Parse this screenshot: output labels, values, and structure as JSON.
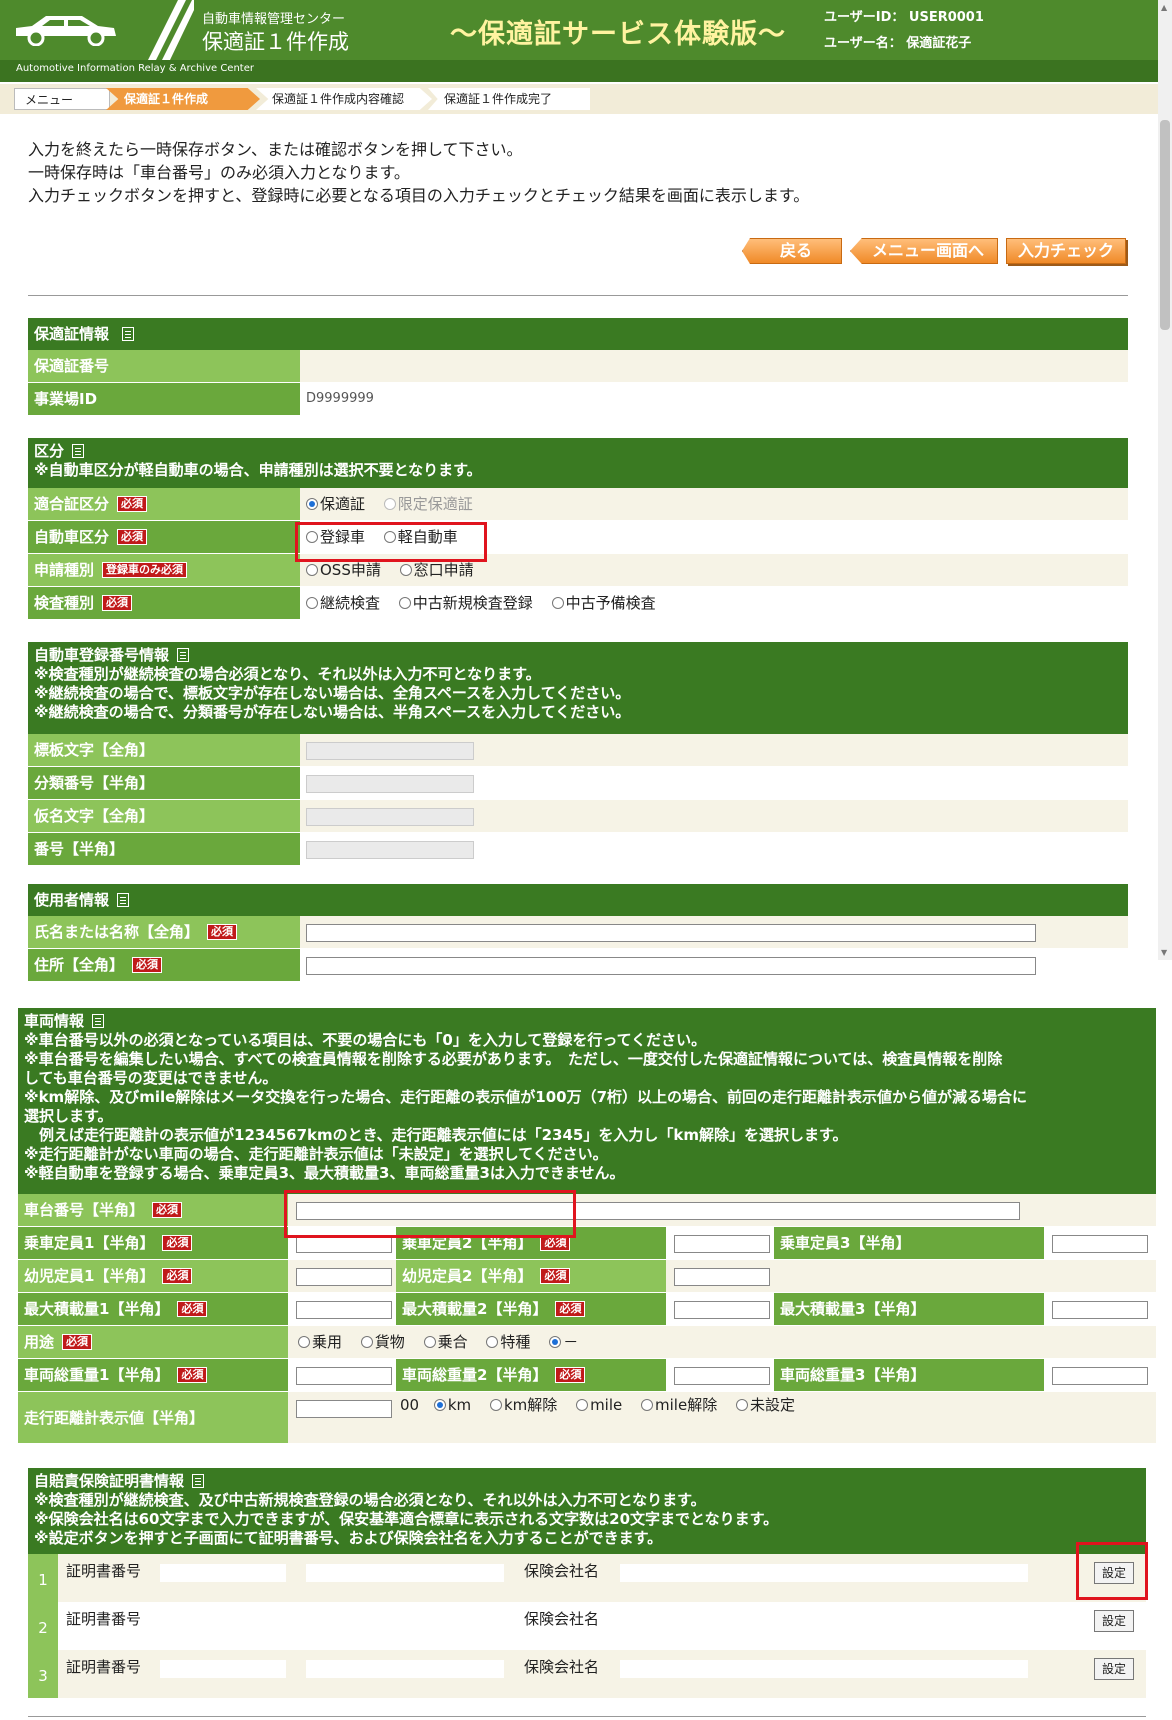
{
  "header": {
    "org": "自動車情報管理センター",
    "subtitle": "保適証１件作成",
    "title": "～保適証サービス体験版～",
    "user_id": "ユーザーID： USER0001",
    "user_name": "ユーザー名： 保適証花子",
    "english": "Automotive Information Relay & Archive Center"
  },
  "breadcrumb": [
    "メニュー",
    "保適証１件作成",
    "保適証１件作成内容確認",
    "保適証１件作成完了"
  ],
  "instructions": [
    "入力を終えたら一時保存ボタン、または確認ボタンを押して下さい。",
    "一時保存時は「車台番号」のみ必須入力となります。",
    "入力チェックボタンを押すと、登録時に必要となる項目の入力チェックとチェック結果を画面に表示します。"
  ],
  "buttons": {
    "back": "戻る",
    "menu": "メニュー画面へ",
    "check": "入力チェック"
  },
  "req_label": "必須",
  "req_reg_only": "登録車のみ必須",
  "sec1": {
    "title": "保適証情報",
    "rows": [
      {
        "label": "保適証番号",
        "value": ""
      },
      {
        "label": "事業場ID",
        "value": "D9999999"
      }
    ]
  },
  "sec2": {
    "title": "区分",
    "note": "※自動車区分が軽自動車の場合、申請種別は選択不要となります。",
    "rows": [
      {
        "label": "適合証区分",
        "options": [
          "保適証",
          "限定保適証"
        ]
      },
      {
        "label": "自動車区分",
        "options": [
          "登録車",
          "軽自動車"
        ]
      },
      {
        "label": "申請種別",
        "options": [
          "OSS申請",
          "窓口申請"
        ]
      },
      {
        "label": "検査種別",
        "options": [
          "継続検査",
          "中古新規検査登録",
          "中古予備検査"
        ]
      }
    ]
  },
  "sec3": {
    "title": "自動車登録番号情報",
    "notes": [
      "※検査種別が継続検査の場合必須となり、それ以外は入力不可となります。",
      "※継続検査の場合で、標板文字が存在しない場合は、全角スペースを入力してください。",
      "※継続検査の場合で、分類番号が存在しない場合は、半角スペースを入力してください。"
    ],
    "rows": [
      "標板文字【全角】",
      "分類番号【半角】",
      "仮名文字【全角】",
      "番号【半角】"
    ]
  },
  "sec4": {
    "title": "使用者情報",
    "rows": [
      "氏名または名称【全角】",
      "住所【全角】"
    ]
  },
  "sec5": {
    "title": "車両情報",
    "notes": [
      "※車台番号以外の必須となっている項目は、不要の場合にも「0」を入力して登録を行ってください。",
      "※車台番号を編集したい場合、すべての検査員情報を削除する必要があります。　ただし、一度交付した保適証情報については、検査員情報を削除",
      "しても車台番号の変更はできません。",
      "※km解除、及びmile解除はメータ交換を行った場合、走行距離の表示値が100万（7桁）以上の場合、前回の走行距離計表示値から値が減る場合に",
      "選択します。",
      "　例えば走行距離計の表示値が1234567kmのとき、走行距離表示値には「2345」を入力し「km解除」を選択します。",
      "※走行距離計がない車両の場合、走行距離計表示値は「未設定」を選択してください。",
      "※軽自動車を登録する場合、乗車定員3、最大積載量3、車両総重量3は入力できません。"
    ],
    "chassis": "車台番号【半角】",
    "cap": [
      "乗車定員1【半角】",
      "乗車定員2【半角】",
      "乗車定員3【半角】"
    ],
    "infant": [
      "幼児定員1【半角】",
      "幼児定員2【半角】"
    ],
    "load": [
      "最大積載量1【半角】",
      "最大積載量2【半角】",
      "最大積載量3【半角】"
    ],
    "use_label": "用途",
    "use_options": [
      "乗用",
      "貨物",
      "乗合",
      "特種",
      "－"
    ],
    "gross": [
      "車両総重量1【半角】",
      "車両総重量2【半角】",
      "車両総重量3【半角】"
    ],
    "odo_label": "走行距離計表示値【半角】",
    "odo_suffix": "00",
    "odo_options": [
      "km",
      "km解除",
      "mile",
      "mile解除",
      "未設定"
    ]
  },
  "sec6": {
    "title": "自賠責保険証明書情報",
    "notes": [
      "※検査種別が継続検査、及び中古新規検査登録の場合必須となり、それ以外は入力不可となります。",
      "※保険会社名は60文字まで入力できますが、保安基準適合標章に表示される文字数は20文字までとなります。",
      "※設定ボタンを押すと子画面にて証明書番号、および保険会社名を入力することができます。"
    ],
    "rows": [
      {
        "no": "1",
        "cert": "証明書番号",
        "company": "保険会社名",
        "btn": "設定"
      },
      {
        "no": "2",
        "cert": "証明書番号",
        "company": "保険会社名",
        "btn": "設定"
      },
      {
        "no": "3",
        "cert": "証明書番号",
        "company": "保険会社名",
        "btn": "設定"
      }
    ]
  }
}
